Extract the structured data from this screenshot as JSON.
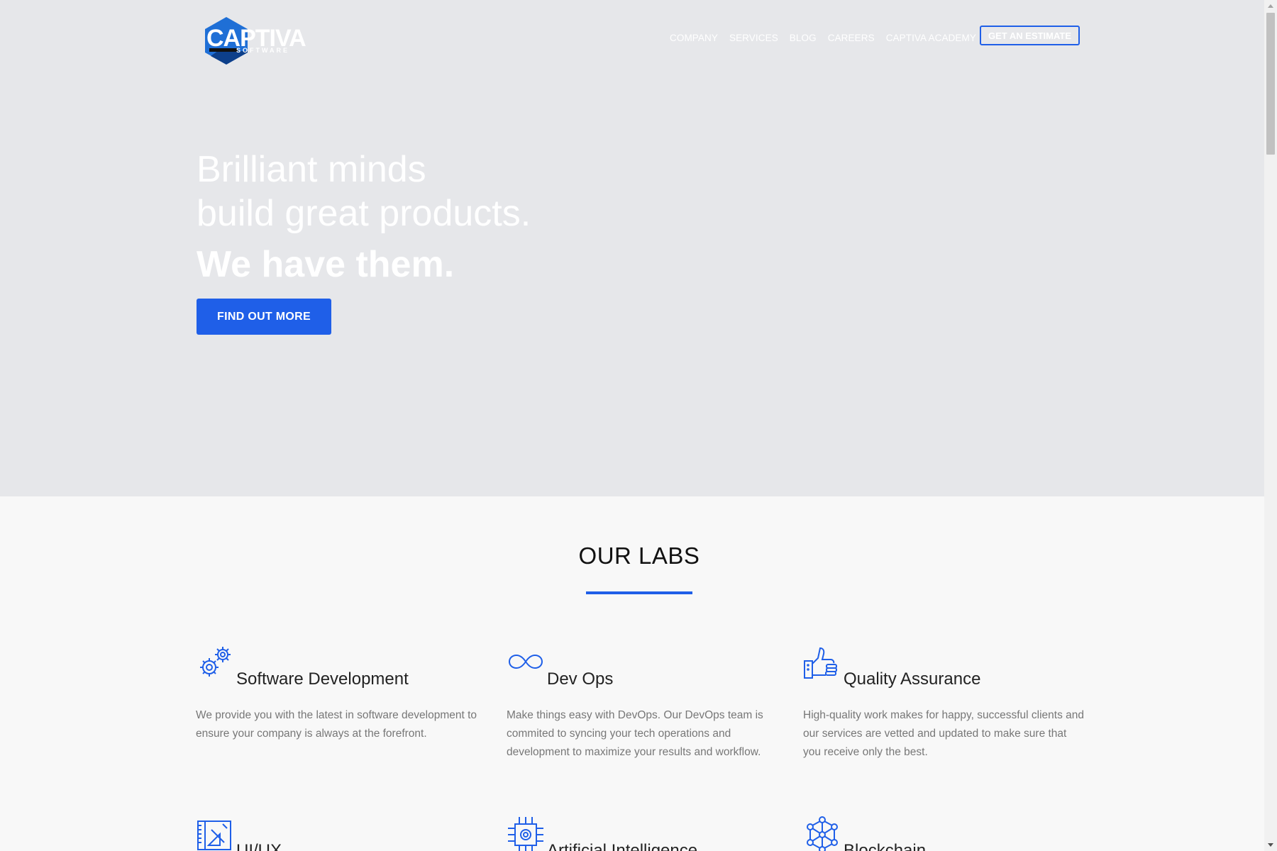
{
  "brand": {
    "logo_text": "CAPTIVA",
    "logo_sub": "SOFTWARE",
    "accent_color": "#1f5fe8"
  },
  "nav": {
    "items": [
      {
        "label": "COMPANY"
      },
      {
        "label": "SERVICES"
      },
      {
        "label": "BLOG"
      },
      {
        "label": "CAREERS"
      },
      {
        "label": "CAPTIVA ACADEMY"
      }
    ],
    "estimate_label": "GET AN ESTIMATE"
  },
  "hero": {
    "line1": "Brilliant minds",
    "line2": "build great products.",
    "line3": "We have them.",
    "cta_label": "FIND OUT MORE"
  },
  "labs": {
    "title": "OUR LABS",
    "items": [
      {
        "icon": "gears-icon",
        "title": "Software Development",
        "description": "We provide you with the latest in software development to ensure your company is always at the forefront."
      },
      {
        "icon": "infinity-icon",
        "title": "Dev Ops",
        "description": "Make things easy with DevOps. Our DevOps team is commited to syncing your tech operations and development to maximize your results and workflow."
      },
      {
        "icon": "thumbs-up-icon",
        "title": "Quality Assurance",
        "description": "High-quality work makes for happy, successful clients and our services are vetted and updated to make sure that you receive only the best."
      },
      {
        "icon": "design-tools-icon",
        "title": "UI/UX",
        "description": ""
      },
      {
        "icon": "chip-icon",
        "title": "Artificial Intelligence",
        "description": ""
      },
      {
        "icon": "network-icon",
        "title": "Blockchain",
        "description": ""
      }
    ]
  }
}
